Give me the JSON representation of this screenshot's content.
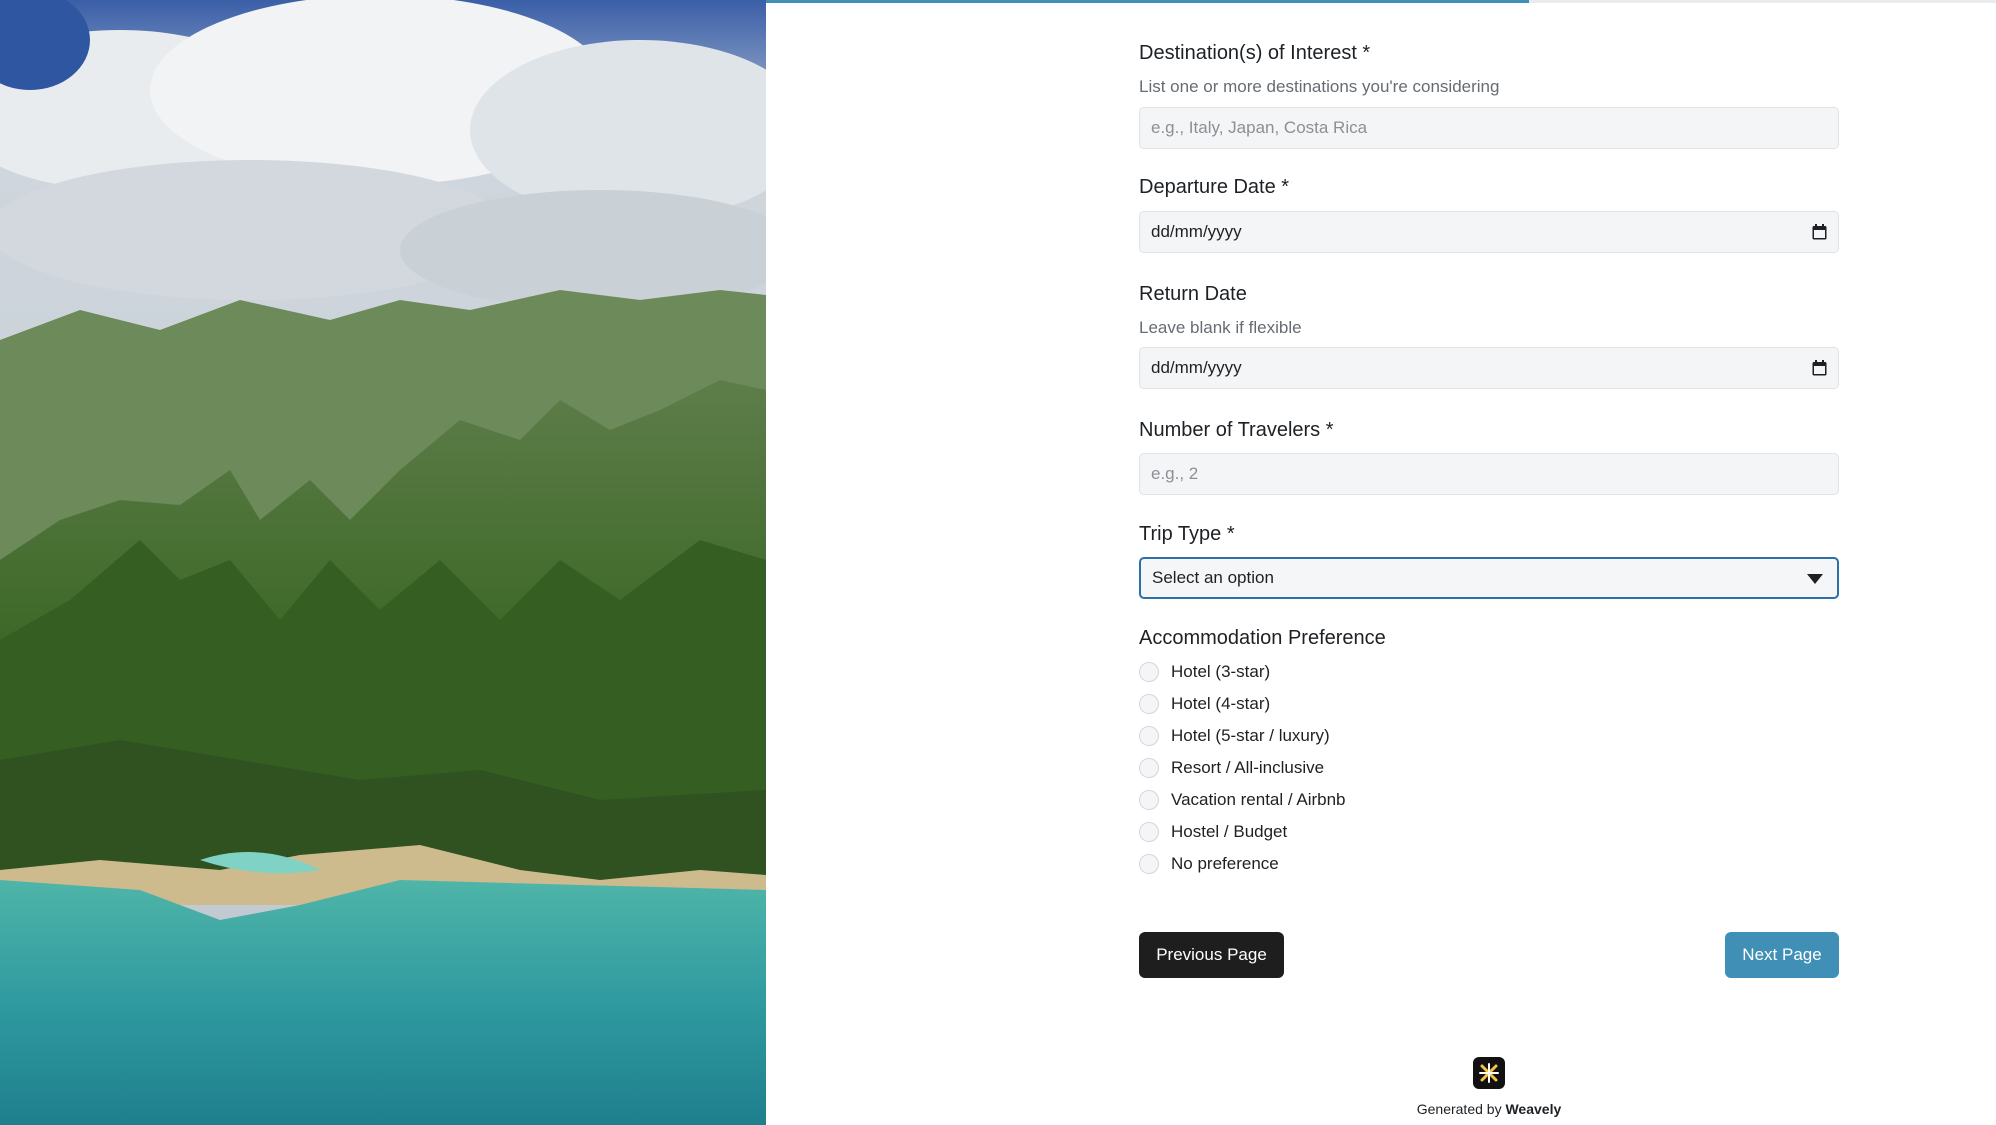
{
  "progress": {
    "fraction": 0.62,
    "color": "#3f8fb6"
  },
  "form": {
    "destinations": {
      "label": "Destination(s) of Interest *",
      "helper": "List one or more destinations you're considering",
      "placeholder": "e.g., Italy, Japan, Costa Rica"
    },
    "departure_date": {
      "label": "Departure Date *",
      "value": "dd/mm/yyyy",
      "icon": "calendar-icon"
    },
    "return_date": {
      "label": "Return Date",
      "helper": "Leave blank if flexible",
      "value": "dd/mm/yyyy",
      "icon": "calendar-icon"
    },
    "travelers": {
      "label": "Number of Travelers *",
      "placeholder": "e.g., 2"
    },
    "trip_type": {
      "label": "Trip Type *",
      "selected": "Select an option",
      "icon": "caret-down-icon"
    },
    "accommodation": {
      "label": "Accommodation Preference",
      "options": [
        "Hotel (3-star)",
        "Hotel (4-star)",
        "Hotel (5-star / luxury)",
        "Resort / All-inclusive",
        "Vacation rental / Airbnb",
        "Hostel / Budget",
        "No preference"
      ]
    }
  },
  "buttons": {
    "previous": "Previous Page",
    "next": "Next Page"
  },
  "footer": {
    "prefix": "Generated by",
    "brand": "Weavely",
    "logo_icon": "weavely-logo-icon"
  },
  "colors": {
    "accent": "#3f8fb6",
    "dark_button": "#1e1e1e",
    "focus_border": "#2d6fa8"
  }
}
